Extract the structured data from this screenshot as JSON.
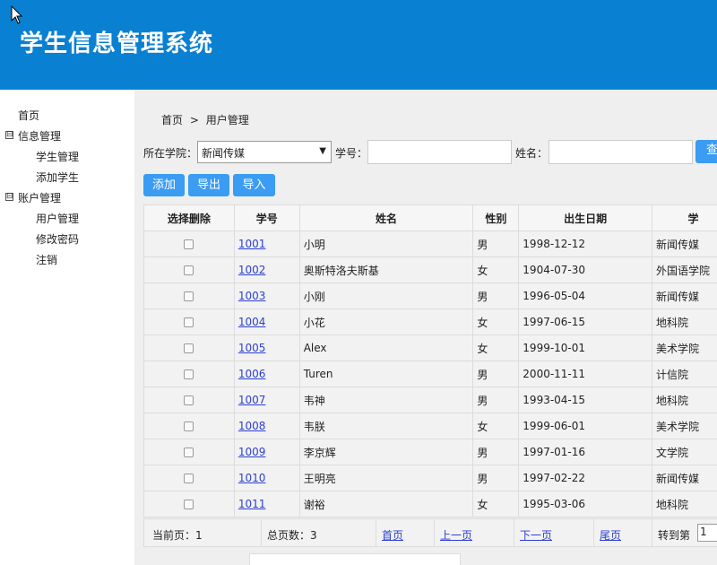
{
  "header": {
    "title": "学生信息管理系统"
  },
  "sidebar": {
    "home": "首页",
    "groups": [
      {
        "toggle": "⊟",
        "label": "信息管理",
        "items": [
          "学生管理",
          "添加学生"
        ]
      },
      {
        "toggle": "⊟",
        "label": "账户管理",
        "items": [
          "用户管理",
          "修改密码",
          "注销"
        ]
      }
    ]
  },
  "breadcrumb": {
    "home": "首页",
    "sep": ">",
    "current": "用户管理"
  },
  "filter": {
    "college_label": "所在学院：",
    "college_value": "新闻传媒",
    "id_label": "学号：",
    "name_label": "姓名：",
    "search_label": "查"
  },
  "actions": {
    "add": "添加",
    "export": "导出",
    "import": "导入"
  },
  "table": {
    "headers": [
      "选择删除",
      "学号",
      "姓名",
      "性别",
      "出生日期",
      "学"
    ],
    "rows": [
      {
        "id": "1001",
        "name": "小明",
        "gender": "男",
        "birth": "1998-12-12",
        "college": "新闻传媒"
      },
      {
        "id": "1002",
        "name": "奥斯特洛夫斯基",
        "gender": "女",
        "birth": "1904-07-30",
        "college": "外国语学院"
      },
      {
        "id": "1003",
        "name": "小刚",
        "gender": "男",
        "birth": "1996-05-04",
        "college": "新闻传媒"
      },
      {
        "id": "1004",
        "name": "小花",
        "gender": "女",
        "birth": "1997-06-15",
        "college": "地科院"
      },
      {
        "id": "1005",
        "name": "Alex",
        "gender": "女",
        "birth": "1999-10-01",
        "college": "美术学院"
      },
      {
        "id": "1006",
        "name": "Turen",
        "gender": "男",
        "birth": "2000-11-11",
        "college": "计信院"
      },
      {
        "id": "1007",
        "name": "韦神",
        "gender": "男",
        "birth": "1993-04-15",
        "college": "地科院"
      },
      {
        "id": "1008",
        "name": "韦朕",
        "gender": "女",
        "birth": "1999-06-01",
        "college": "美术学院"
      },
      {
        "id": "1009",
        "name": "李京辉",
        "gender": "男",
        "birth": "1997-01-16",
        "college": "文学院"
      },
      {
        "id": "1010",
        "name": "王明亮",
        "gender": "男",
        "birth": "1997-02-22",
        "college": "新闻传媒"
      },
      {
        "id": "1011",
        "name": "谢裕",
        "gender": "女",
        "birth": "1995-03-06",
        "college": "地科院"
      }
    ]
  },
  "pager": {
    "current": "当前页：1",
    "total": "总页数：3",
    "first": "首页",
    "prev": "上一页",
    "next": "下一页",
    "last": "尾页",
    "goto_label": "转到第",
    "goto_value": "1"
  },
  "colors": {
    "header": "#0a80d2",
    "button": "#3a9cf3",
    "link": "#2b3fd0"
  }
}
